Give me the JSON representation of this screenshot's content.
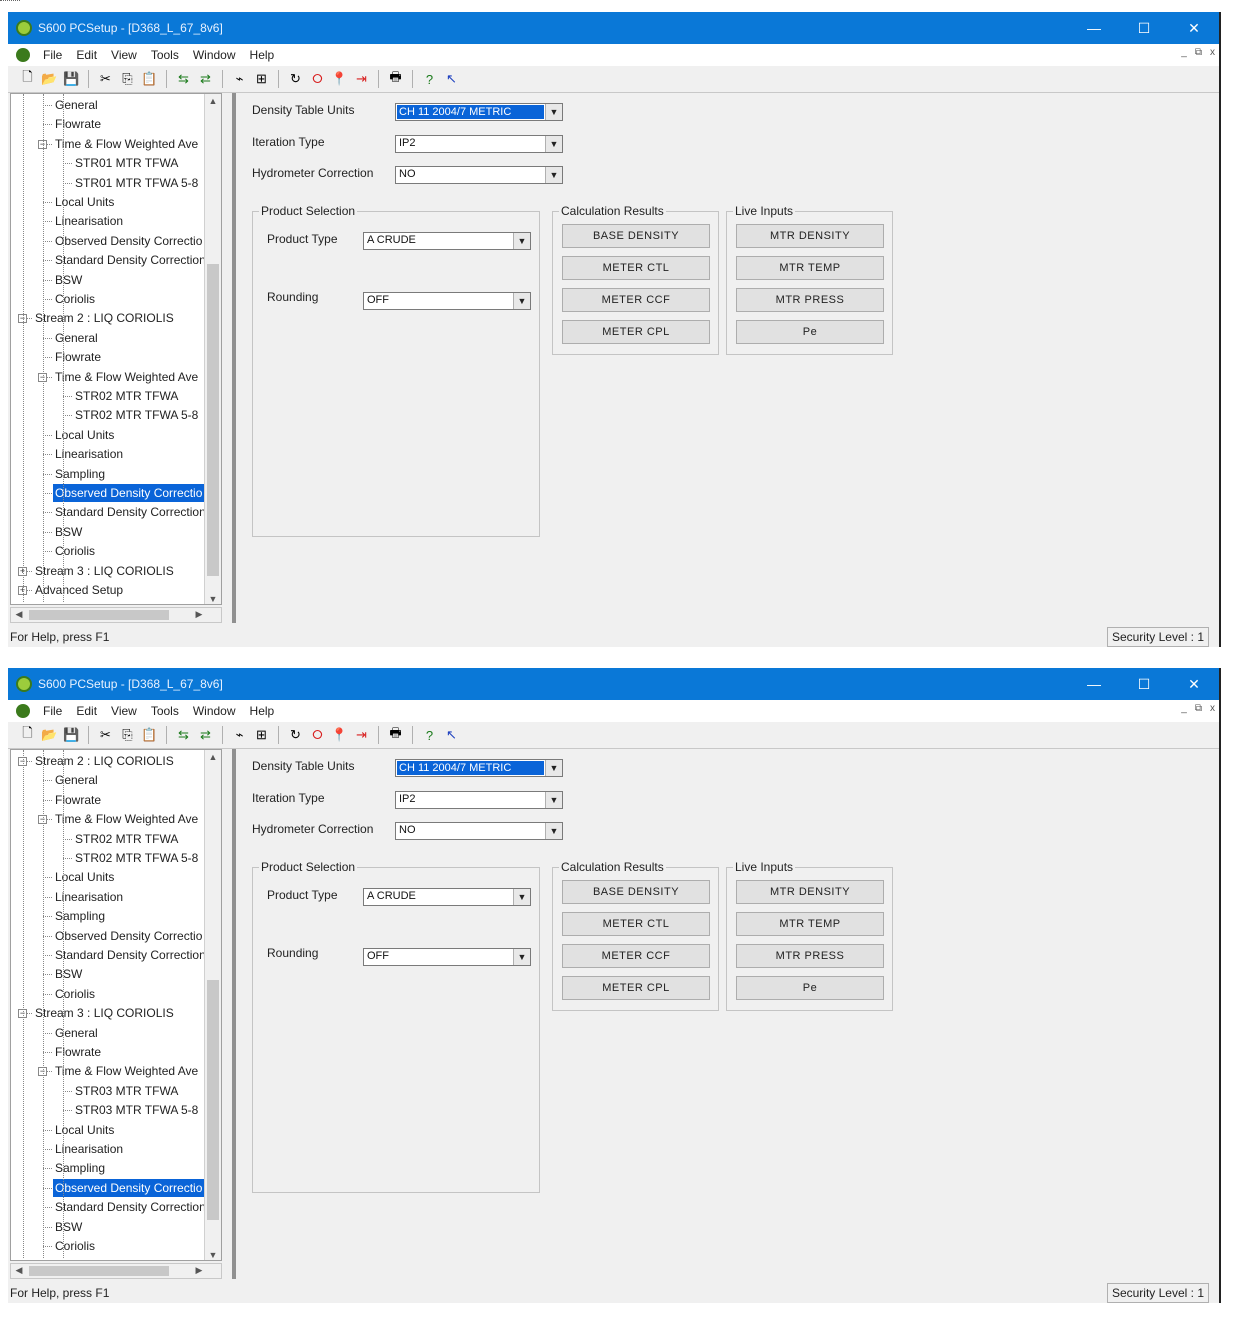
{
  "window": {
    "title": "S600 PCSetup - [D368_L_67_8v6]",
    "controls": {
      "minimize": "—",
      "maximize": "☐",
      "close": "✕"
    }
  },
  "menu": [
    "File",
    "Edit",
    "View",
    "Tools",
    "Window",
    "Help"
  ],
  "mdi_controls": {
    "minimize": "_",
    "restore": "⧉",
    "close": "x"
  },
  "toolbar_icons": [
    "new-file-icon",
    "open-folder-icon",
    "save-icon",
    "cut-icon",
    "copy-icon",
    "paste-icon",
    "send-icon",
    "receive-icon",
    "connect-icon",
    "disconnect-icon",
    "refresh-icon",
    "stop-icon",
    "pin-icon",
    "exit-icon",
    "print-icon",
    "help-icon",
    "context-help-icon"
  ],
  "form": {
    "density_table_units_label": "Density Table Units",
    "density_table_units_value": "CH 11 2004/7 METRIC",
    "iteration_type_label": "Iteration Type",
    "iteration_type_value": "IP2",
    "hydrometer_correction_label": "Hydrometer Correction",
    "hydrometer_correction_value": "NO",
    "product_selection_caption": "Product Selection",
    "product_type_label": "Product Type",
    "product_type_value": "A CRUDE",
    "rounding_label": "Rounding",
    "rounding_value": "OFF",
    "calculation_results_caption": "Calculation Results",
    "calc_buttons": [
      "BASE DENSITY",
      "METER CTL",
      "METER CCF",
      "METER CPL"
    ],
    "live_inputs_caption": "Live Inputs",
    "live_buttons": [
      "MTR DENSITY",
      "MTR TEMP",
      "MTR PRESS",
      "Pe"
    ]
  },
  "status": {
    "help": "For Help, press F1",
    "security": "Security Level : 1"
  },
  "tree1": [
    {
      "label": "General",
      "level": 2
    },
    {
      "label": "Flowrate",
      "level": 2
    },
    {
      "label": "Time & Flow Weighted Ave",
      "level": 2,
      "expander": "−"
    },
    {
      "label": "STR01 MTR TFWA",
      "level": 3
    },
    {
      "label": "STR01 MTR TFWA 5-8",
      "level": 3
    },
    {
      "label": "Local Units",
      "level": 2
    },
    {
      "label": "Linearisation",
      "level": 2
    },
    {
      "label": "Observed Density Correctio",
      "level": 2
    },
    {
      "label": "Standard Density Correction",
      "level": 2
    },
    {
      "label": "BSW",
      "level": 2
    },
    {
      "label": "Coriolis",
      "level": 2
    },
    {
      "label": "Stream 2 : LIQ CORIOLIS",
      "level": 1,
      "expander": "−"
    },
    {
      "label": "General",
      "level": 2
    },
    {
      "label": "Flowrate",
      "level": 2
    },
    {
      "label": "Time & Flow Weighted Ave",
      "level": 2,
      "expander": "−"
    },
    {
      "label": "STR02 MTR TFWA",
      "level": 3
    },
    {
      "label": "STR02 MTR TFWA 5-8",
      "level": 3
    },
    {
      "label": "Local Units",
      "level": 2
    },
    {
      "label": "Linearisation",
      "level": 2
    },
    {
      "label": "Sampling",
      "level": 2
    },
    {
      "label": "Observed Density Correctio",
      "level": 2,
      "selected": true
    },
    {
      "label": "Standard Density Correction",
      "level": 2
    },
    {
      "label": "BSW",
      "level": 2
    },
    {
      "label": "Coriolis",
      "level": 2
    },
    {
      "label": "Stream 3 : LIQ CORIOLIS",
      "level": 1,
      "expander": "+"
    },
    {
      "label": "Advanced Setup",
      "level": 1,
      "expander": "+"
    }
  ],
  "tree2": [
    {
      "label": "Stream 2 : LIQ CORIOLIS",
      "level": 1,
      "expander": "−"
    },
    {
      "label": "General",
      "level": 2
    },
    {
      "label": "Flowrate",
      "level": 2
    },
    {
      "label": "Time & Flow Weighted Ave",
      "level": 2,
      "expander": "−"
    },
    {
      "label": "STR02 MTR TFWA",
      "level": 3
    },
    {
      "label": "STR02 MTR TFWA 5-8",
      "level": 3
    },
    {
      "label": "Local Units",
      "level": 2
    },
    {
      "label": "Linearisation",
      "level": 2
    },
    {
      "label": "Sampling",
      "level": 2
    },
    {
      "label": "Observed Density Correctio",
      "level": 2
    },
    {
      "label": "Standard Density Correction",
      "level": 2
    },
    {
      "label": "BSW",
      "level": 2
    },
    {
      "label": "Coriolis",
      "level": 2
    },
    {
      "label": "Stream 3 : LIQ CORIOLIS",
      "level": 1,
      "expander": "−"
    },
    {
      "label": "General",
      "level": 2
    },
    {
      "label": "Flowrate",
      "level": 2
    },
    {
      "label": "Time & Flow Weighted Ave",
      "level": 2,
      "expander": "−"
    },
    {
      "label": "STR03 MTR TFWA",
      "level": 3
    },
    {
      "label": "STR03 MTR TFWA 5-8",
      "level": 3
    },
    {
      "label": "Local Units",
      "level": 2
    },
    {
      "label": "Linearisation",
      "level": 2
    },
    {
      "label": "Sampling",
      "level": 2
    },
    {
      "label": "Observed Density Correctio",
      "level": 2,
      "selected": true
    },
    {
      "label": "Standard Density Correction",
      "level": 2
    },
    {
      "label": "BSW",
      "level": 2
    },
    {
      "label": "Coriolis",
      "level": 2
    }
  ]
}
